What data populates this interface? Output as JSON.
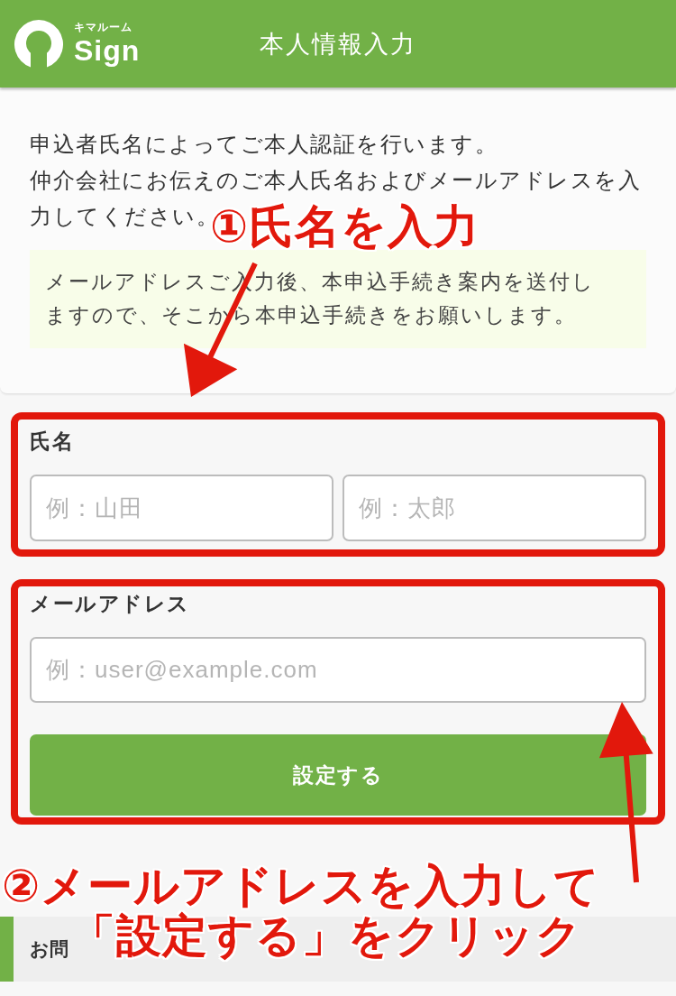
{
  "header": {
    "logo": {
      "subtitle": "キマルーム",
      "name": "Sign"
    },
    "title": "本人情報入力"
  },
  "intro": {
    "lines": [
      "申込者氏名によってご本人認証を行います。",
      "仲介会社にお伝えのご本人氏名およびメールアドレスを入",
      "力してください。"
    ],
    "notice": "メールアドレスご入力後、本申込手続き案内を送付しますので、そこから本申込手続きをお願いします。"
  },
  "form": {
    "name": {
      "label": "氏名",
      "fields": [
        {
          "placeholder": "例：山田"
        },
        {
          "placeholder": "例：太郎"
        }
      ]
    },
    "email": {
      "label": "メールアドレス",
      "placeholder": "例：user@example.com"
    },
    "submit": "設定する"
  },
  "contact_section": {
    "heading": "お問"
  },
  "annotations": [
    {
      "lines": [
        "①氏名を入力"
      ]
    },
    {
      "lines": [
        "②メールアドレスを入力して",
        "「設定する」をクリック"
      ]
    }
  ]
}
